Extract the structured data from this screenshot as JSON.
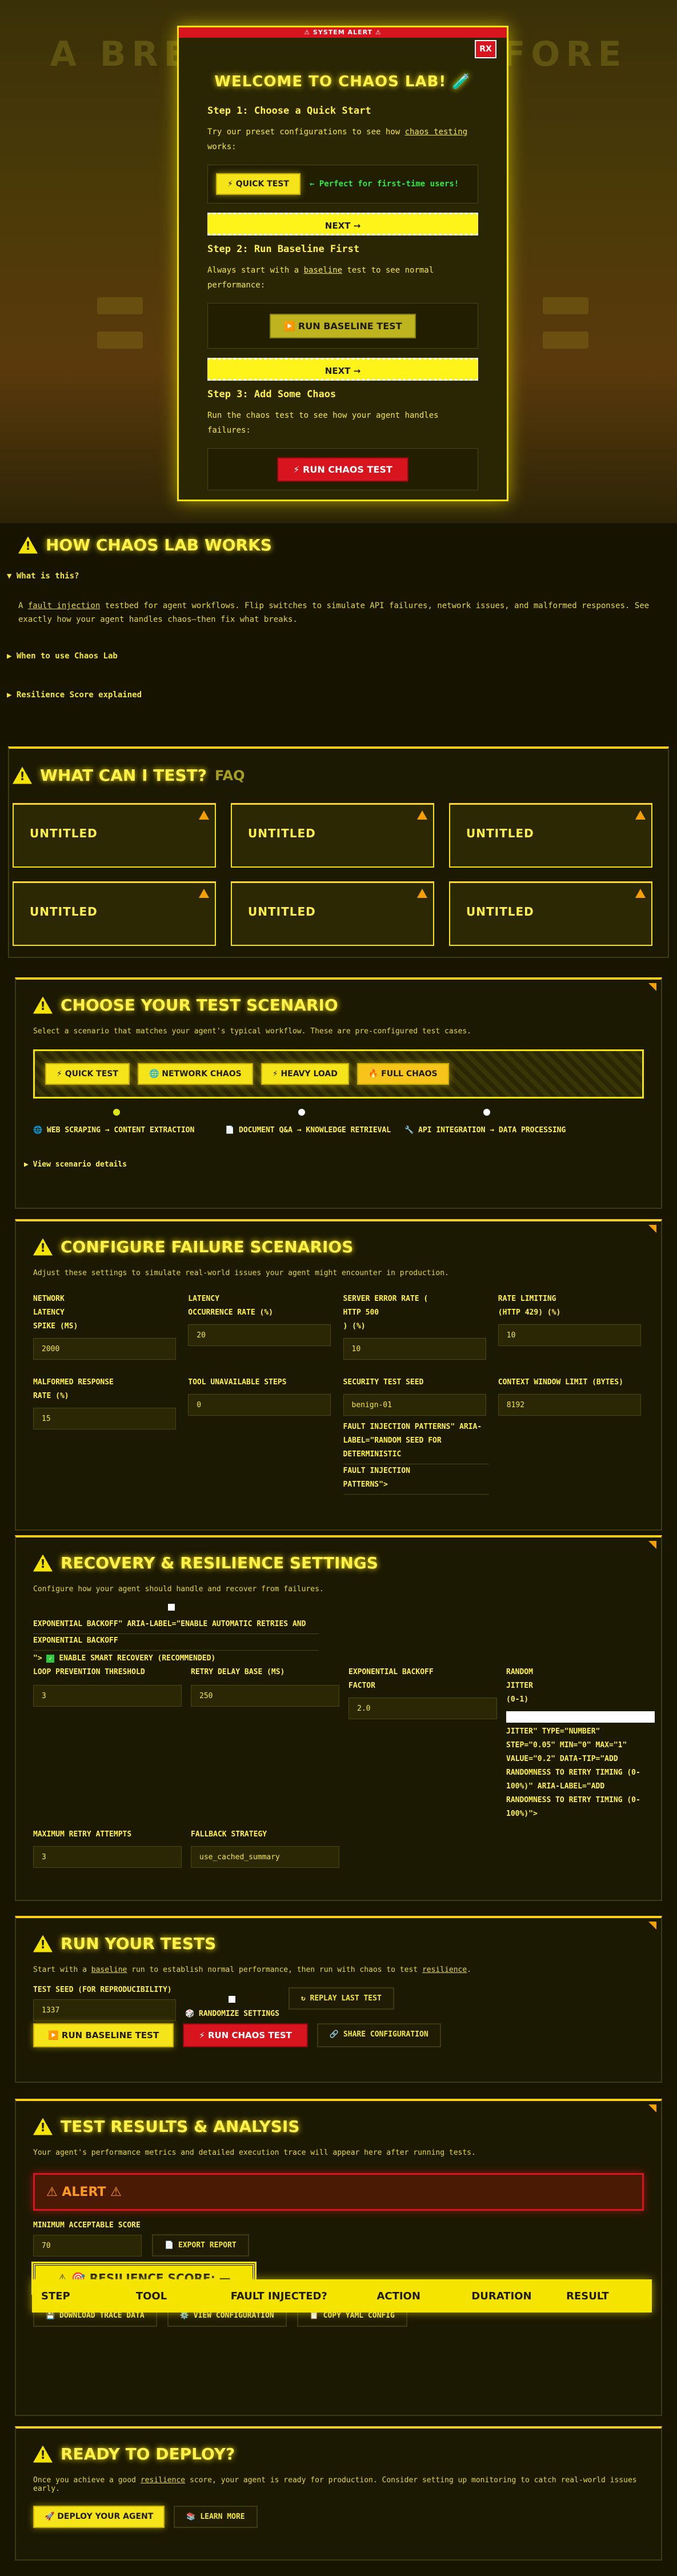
{
  "hero": {
    "bg_title": "A BREAK TESTS BEFORE"
  },
  "modal": {
    "bar": "⚠ SYSTEM ALERT ⚠",
    "close": "RX",
    "title": "WELCOME TO CHAOS LAB! 🧪",
    "step1_title": "Step 1: Choose a Quick Start",
    "step1_desc_a": "Try our preset configurations to see how ",
    "step1_desc_link": "chaos testing",
    "step1_desc_b": " works:",
    "quick_test": "⚡ QUICK TEST",
    "perfect": "← Perfect for first-time users!",
    "next1": "NEXT →",
    "step2_title": "Step 2: Run Baseline First",
    "step2_desc_a": "Always start with a ",
    "step2_desc_link": "baseline",
    "step2_desc_b": " test to see normal performance:",
    "run_baseline": "▶️ RUN BASELINE TEST",
    "next2": "NEXT →",
    "step3_title": "Step 3: Add Some Chaos",
    "step3_desc": "Run the chaos test to see how your agent handles failures:",
    "run_chaos": "⚡ RUN CHAOS TEST"
  },
  "works": {
    "title": "HOW CHAOS LAB WORKS",
    "q1": "▼ What is this?",
    "text_a": "A ",
    "text_link": "fault injection",
    "text_b": " testbed for agent workflows. Flip switches to simulate API failures, network issues, and malformed responses. See exactly how your agent handles chaos—then fix what breaks.",
    "q2": "▶ When to use Chaos Lab",
    "q3": "▶ Resilience Score explained"
  },
  "faq": {
    "title": "WHAT CAN I TEST?",
    "tag": "FAQ",
    "cards": [
      "UNTITLED",
      "UNTITLED",
      "UNTITLED",
      "UNTITLED",
      "UNTITLED",
      "UNTITLED"
    ]
  },
  "scenario": {
    "title": "CHOOSE YOUR TEST SCENARIO",
    "desc": "Select a scenario that matches your agent's typical workflow. These are pre-configured test cases.",
    "buttons": [
      "⚡ QUICK TEST",
      "🌐 NETWORK CHAOS",
      "⚡ HEAVY LOAD",
      "🔥 FULL CHAOS"
    ],
    "options": [
      "🌐 WEB SCRAPING → CONTENT EXTRACTION",
      "📄 DOCUMENT Q&A → KNOWLEDGE RETRIEVAL",
      "🔧 API INTEGRATION → DATA PROCESSING"
    ],
    "details": "▶ View scenario details"
  },
  "failure": {
    "title": "CONFIGURE FAILURE SCENARIOS",
    "desc": "Adjust these settings to simulate real-world issues your agent might encounter in production.",
    "c1_l1": "NETWORK",
    "c1_l2": "LATENCY",
    "c1_l3": "SPIKE (MS)",
    "c1_v": "2000",
    "c2_l1": "LATENCY",
    "c2_l2": "OCCURRENCE RATE (%)",
    "c2_v": "20",
    "c3_l1": "SERVER ERROR RATE (",
    "c3_l2": "HTTP 500",
    "c3_l3": ") (%)",
    "c3_v": "10",
    "c4_l1": "RATE LIMITING",
    "c4_l2": "(HTTP 429) (%)",
    "c4_v": "10",
    "r2_l1": "MALFORMED RESPONSE",
    "r2_l2": "RATE (%)",
    "r2_v": "15",
    "r2b_l": "TOOL UNAVAILABLE STEPS",
    "r2b_v": "0",
    "r2c_l": "SECURITY TEST SEED",
    "r2c_v": "benign-01",
    "r2d_l": "CONTEXT WINDOW LIMIT (BYTES)",
    "r2d_v": "8192",
    "fi_1": "FAULT INJECTION PATTERNS\" ARIA-",
    "fi_2": "LABEL=\"RANDOM SEED FOR",
    "fi_3": "DETERMINISTIC",
    "fi_4": "FAULT INJECTION",
    "fi_5": "PATTERNS\">"
  },
  "recovery": {
    "title": "RECOVERY & RESILIENCE SETTINGS",
    "desc": "Configure how your agent should handle and recover from failures.",
    "chk_1": "EXPONENTIAL BACKOFF\" ARIA-LABEL=\"ENABLE AUTOMATIC RETRIES AND",
    "chk_2": "EXPONENTIAL BACKOFF",
    "chk_3": "\">",
    "chk_4": "ENABLE SMART RECOVERY (RECOMMENDED)",
    "loop_l": "LOOP PREVENTION THRESHOLD",
    "loop_v": "3",
    "retry_l": "RETRY DELAY BASE (MS)",
    "retry_v": "250",
    "exp_l1": "EXPONENTIAL BACKOFF",
    "exp_l2": "FACTOR",
    "exp_v": "2.0",
    "rand_1": "RANDOM",
    "rand_2": "JITTER",
    "rand_3": "(0-1)",
    "rand_4": "JITTER\" TYPE=\"NUMBER\"",
    "rand_5": "STEP=\"0.05\" MIN=\"0\" MAX=\"1\"",
    "rand_6": "VALUE=\"0.2\" DATA-TIP=\"ADD",
    "rand_7": "RANDOMNESS TO RETRY TIMING (0-",
    "rand_8": "100%)\" ARIA-LABEL=\"ADD",
    "rand_9": "RANDOMNESS TO RETRY TIMING (0-",
    "rand_10": "100%)\">",
    "max_l": "MAXIMUM RETRY ATTEMPTS",
    "max_v": "3",
    "fb_l": "FALLBACK STRATEGY",
    "fb_v": "use_cached_summary"
  },
  "run": {
    "title": "RUN YOUR TESTS",
    "desc_a": "Start with a ",
    "desc_link1": "baseline",
    "desc_b": " run to establish normal performance, then run with chaos to test ",
    "desc_link2": "resilience",
    "desc_c": ".",
    "seed_l": "TEST SEED (FOR REPRODUCIBILITY)",
    "seed_v": "1337",
    "randomize": "🎲 RANDOMIZE SETTINGS",
    "replay": "↻ REPLAY LAST TEST",
    "baseline": "▶️ RUN BASELINE TEST",
    "chaos": "⚡ RUN CHAOS TEST",
    "share": "🔗 SHARE CONFIGURATION"
  },
  "results": {
    "title": "TEST RESULTS & ANALYSIS",
    "desc": "Your agent's performance metrics and detailed execution trace will appear here after running tests.",
    "alert": "⚠ ALERT ⚠",
    "min_l": "MINIMUM ACCEPTABLE SCORE",
    "min_v": "70",
    "export": "📄 EXPORT REPORT",
    "score": "⚠ 🎯 RESILIENCE SCORE: —",
    "download": "💾 DOWNLOAD TRACE DATA",
    "view": "⚙️ VIEW CONFIGURATION",
    "copy": "📋 COPY YAML CONFIG",
    "cols": [
      "STEP",
      "TOOL",
      "FAULT INJECTED?",
      "ACTION",
      "DURATION",
      "RESULT"
    ]
  },
  "deploy": {
    "title": "READY TO DEPLOY?",
    "desc_a": "Once you achieve a good ",
    "desc_link": "resilience",
    "desc_b": " score, your agent is ready for production. Consider setting up monitoring to catch real-world issues early.",
    "deploy": "🚀 DEPLOY YOUR AGENT",
    "learn": "📚 LEARN MORE"
  }
}
